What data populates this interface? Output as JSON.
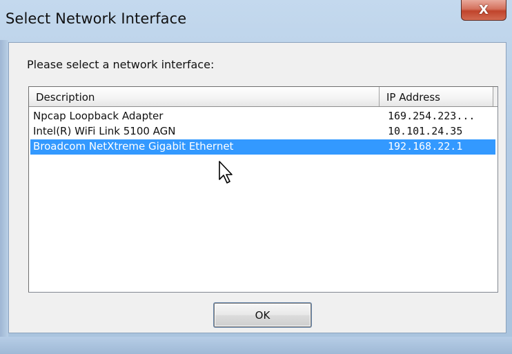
{
  "window": {
    "title": "Select Network Interface",
    "close_label": "X"
  },
  "dialog": {
    "prompt": "Please select a network interface:",
    "columns": [
      "Description",
      "IP Address"
    ],
    "rows": [
      {
        "description": "Npcap Loopback Adapter",
        "ip": "169.254.223...",
        "selected": false
      },
      {
        "description": "Intel(R) WiFi Link 5100 AGN",
        "ip": "10.101.24.35",
        "selected": false
      },
      {
        "description": "Broadcom NetXtreme Gigabit Ethernet",
        "ip": "192.168.22.1",
        "selected": true
      }
    ],
    "ok_label": "OK"
  },
  "colors": {
    "selection": "#3399ff",
    "close_button": "#c0442b"
  },
  "icons": {
    "close": "close-icon",
    "cursor": "mouse-pointer-icon"
  }
}
